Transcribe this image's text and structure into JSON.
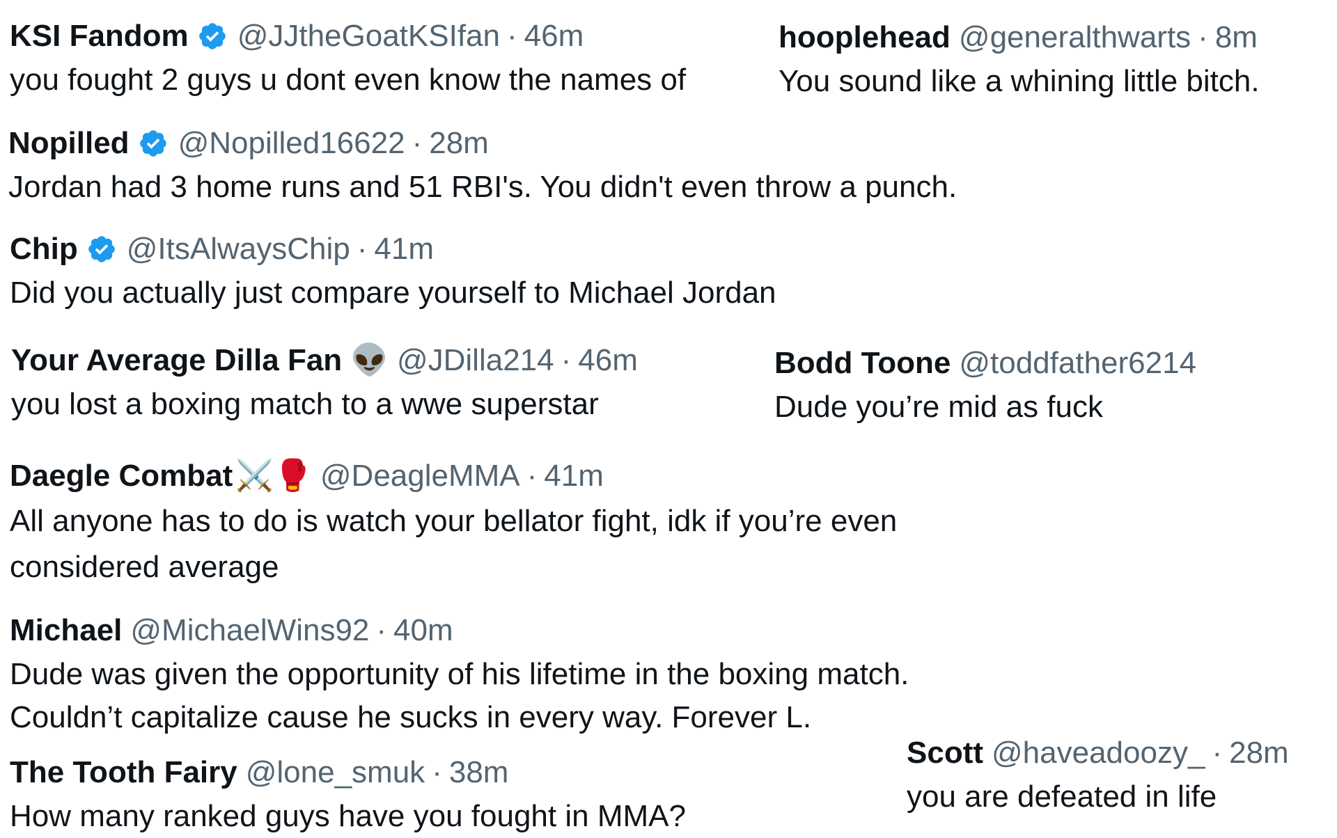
{
  "replies": [
    {
      "name": "KSI Fandom",
      "verified": true,
      "handle": "@JJtheGoatKSIfan",
      "sep": "·",
      "time": "46m",
      "text": [
        "you fought 2 guys u dont even know the names of"
      ]
    },
    {
      "name": "hooplehead",
      "verified": false,
      "handle": "@generalthwarts",
      "sep": "·",
      "time": "8m",
      "text": [
        "You sound like a whining little bitch."
      ]
    },
    {
      "name": "Nopilled",
      "verified": true,
      "handle": "@Nopilled16622",
      "sep": "·",
      "time": "28m",
      "text": [
        "Jordan had 3 home runs and 51 RBI's. You didn't even throw a punch."
      ]
    },
    {
      "name": "Chip",
      "verified": true,
      "handle": "@ItsAlwaysChip",
      "sep": "·",
      "time": "41m",
      "text": [
        "Did you actually just compare yourself to Michael Jordan"
      ]
    },
    {
      "name": "Your Average Dilla Fan",
      "emoji": "👽",
      "handle": "@JDilla214",
      "sep": "·",
      "time": "46m",
      "text": [
        "you lost a boxing match to a wwe superstar"
      ]
    },
    {
      "name": "Bodd Toone",
      "verified": false,
      "handle": "@toddfather6214",
      "text": [
        "Dude you’re mid as fuck"
      ]
    },
    {
      "name": "Daegle Combat",
      "emoji": "⚔️🥊",
      "handle": "@DeagleMMA",
      "sep": "·",
      "time": "41m",
      "text": [
        "All anyone has to do is watch your bellator fight, idk if you’re even",
        "considered average"
      ]
    },
    {
      "name": "Michael",
      "verified": false,
      "handle": "@MichaelWins92",
      "sep": "·",
      "time": "40m",
      "text": [
        "Dude was given the opportunity of his lifetime in the boxing match.",
        "Couldn’t capitalize cause he sucks in every way. Forever L."
      ]
    },
    {
      "name": "The Tooth Fairy",
      "verified": false,
      "handle": "@lone_smuk",
      "sep": "·",
      "time": "38m",
      "text": [
        "How many ranked guys have you fought in MMA?"
      ]
    },
    {
      "name": "Scott",
      "verified": false,
      "handle": "@haveadoozy_",
      "sep": "·",
      "time": "28m",
      "text": [
        "you are defeated in life"
      ]
    }
  ],
  "colors": {
    "verified": "#1d9bf0",
    "muted": "#536471",
    "text": "#0f1419"
  },
  "icons": {
    "verified": "verified-badge-icon"
  }
}
